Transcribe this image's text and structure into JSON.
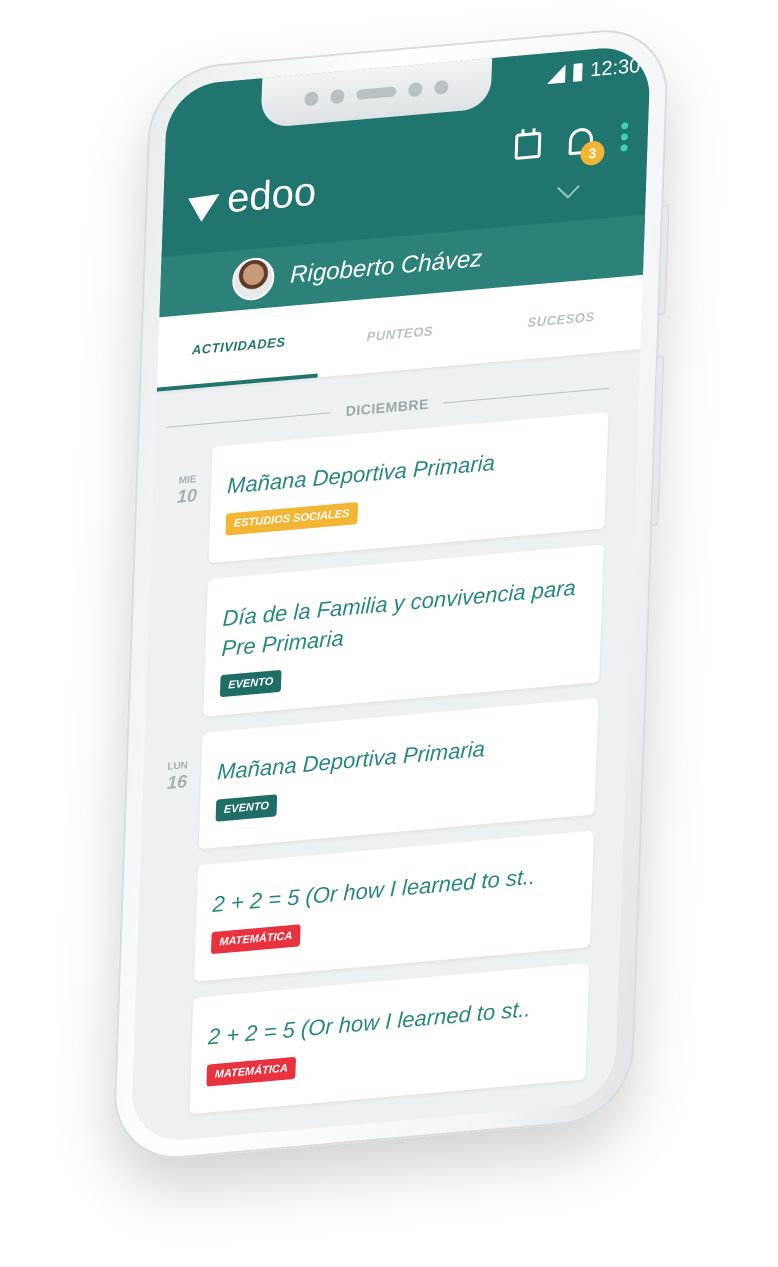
{
  "status": {
    "time": "12:30"
  },
  "header": {
    "brand": "edoo",
    "notification_count": "3",
    "user_name": "Rigoberto Chávez"
  },
  "tabs": [
    {
      "label": "ACTIVIDADES",
      "active": true
    },
    {
      "label": "PUNTEOS",
      "active": false
    },
    {
      "label": "SUCESOS",
      "active": false
    }
  ],
  "month": "DICIEMBRE",
  "days": [
    {
      "day_name": "MIE",
      "day_num": "10",
      "events": [
        {
          "title": "Mañana Deportiva Primaria",
          "tag": "ESTUDIOS SOCIALES",
          "tag_color": "#f2b534"
        },
        {
          "title": "Día de la Familia y convivencia para Pre Primaria",
          "tag": "EVENTO",
          "tag_color": "#1f6e66"
        }
      ]
    },
    {
      "day_name": "LUN",
      "day_num": "16",
      "events": [
        {
          "title": "Mañana Deportiva Primaria",
          "tag": "EVENTO",
          "tag_color": "#1f6e66"
        },
        {
          "title": "2 + 2 = 5 (Or how I learned to st..",
          "tag": "MATEMÁTICA",
          "tag_color": "#e8323e"
        },
        {
          "title": "2 + 2 = 5 (Or how I learned to st..",
          "tag": "MATEMÁTICA",
          "tag_color": "#e8323e"
        }
      ]
    }
  ],
  "colors": {
    "primary": "#21756f",
    "accent": "#3fd1b2",
    "badge": "#f2b534"
  }
}
